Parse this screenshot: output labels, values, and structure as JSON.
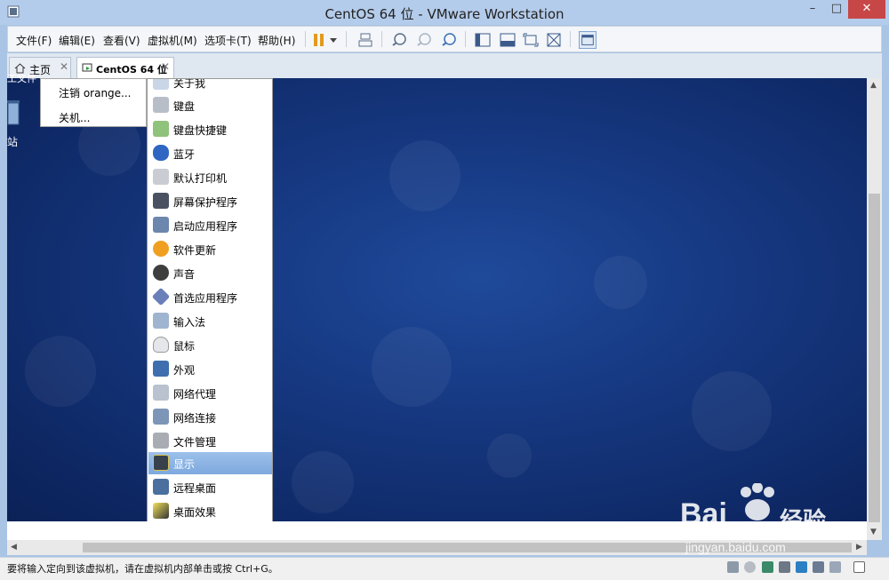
{
  "window": {
    "title": "CentOS 64 位 - VMware Workstation"
  },
  "menubar": {
    "file": "文件(F)",
    "edit": "编辑(E)",
    "view": "查看(V)",
    "vm": "虚拟机(M)",
    "tabs": "选项卡(T)",
    "help": "帮助(H)"
  },
  "tabs": [
    {
      "label": "主页"
    },
    {
      "label": "CentOS 64 位"
    }
  ],
  "user_menu": {
    "logout": "注销 orange...",
    "shutdown": "关机..."
  },
  "prefs_menu": {
    "items": [
      {
        "label": "关于我",
        "icon": "about-me-icon"
      },
      {
        "label": "键盘",
        "icon": "keyboard-icon"
      },
      {
        "label": "键盘快捷键",
        "icon": "keyboard-shortcuts-icon"
      },
      {
        "label": "蓝牙",
        "icon": "bluetooth-icon"
      },
      {
        "label": "默认打印机",
        "icon": "printer-icon"
      },
      {
        "label": "屏幕保护程序",
        "icon": "screensaver-icon"
      },
      {
        "label": "启动应用程序",
        "icon": "startup-apps-icon"
      },
      {
        "label": "软件更新",
        "icon": "software-update-icon"
      },
      {
        "label": "声音",
        "icon": "sound-icon"
      },
      {
        "label": "首选应用程序",
        "icon": "preferred-apps-icon"
      },
      {
        "label": "输入法",
        "icon": "input-method-icon"
      },
      {
        "label": "鼠标",
        "icon": "mouse-icon"
      },
      {
        "label": "外观",
        "icon": "appearance-icon"
      },
      {
        "label": "网络代理",
        "icon": "network-proxy-icon"
      },
      {
        "label": "网络连接",
        "icon": "network-connections-icon"
      },
      {
        "label": "文件管理",
        "icon": "file-management-icon"
      },
      {
        "label": "显示",
        "icon": "display-icon"
      },
      {
        "label": "远程桌面",
        "icon": "remote-desktop-icon"
      },
      {
        "label": "桌面效果",
        "icon": "desktop-effects-icon"
      }
    ],
    "highlighted": "显示"
  },
  "desktop": {
    "trash_label": "站",
    "top_remnant": "工文件"
  },
  "statusbar": {
    "text": "要将输入定向到该虚拟机，请在虚拟机内部单击或按 Ctrl+G。"
  },
  "watermark": {
    "brand": "Bai",
    "brand_cn": "经验",
    "url": "jingyan.baidu.com"
  },
  "colors": {
    "title_bar": "#b4cceb",
    "close_button": "#c74747",
    "highlight": "#7ea9de",
    "desktop": "#173a84"
  }
}
